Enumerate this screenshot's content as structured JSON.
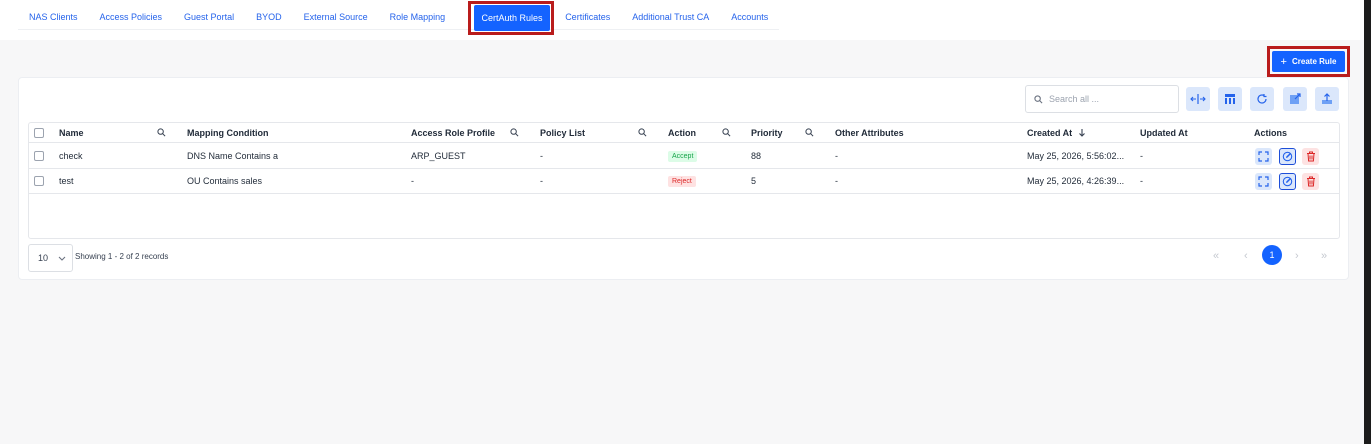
{
  "nav": {
    "tabs": [
      "NAS Clients",
      "Access Policies",
      "Guest Portal",
      "BYOD",
      "External Source",
      "Role Mapping",
      "CertAuth Rules",
      "Certificates",
      "Additional Trust CA",
      "Accounts"
    ],
    "active_tab": "CertAuth Rules"
  },
  "toolbar": {
    "create_label": "Create Rule",
    "search_placeholder": "Search all ..."
  },
  "table": {
    "columns": [
      "Name",
      "Mapping Condition",
      "Access Role Profile",
      "Policy List",
      "Action",
      "Priority",
      "Other Attributes",
      "Created At",
      "Updated At",
      "Actions"
    ],
    "rows": [
      {
        "name": "check",
        "condition": "DNS Name Contains a",
        "role_profile": "ARP_GUEST",
        "policy_list": "-",
        "action": "Accept",
        "priority": "88",
        "other": "-",
        "created": "May 25, 2026, 5:56:02...",
        "updated": "-"
      },
      {
        "name": "test",
        "condition": "OU Contains sales",
        "role_profile": "-",
        "policy_list": "-",
        "action": "Reject",
        "priority": "5",
        "other": "-",
        "created": "May 25, 2026, 4:26:39...",
        "updated": "-"
      }
    ]
  },
  "pagination": {
    "page_size": "10",
    "showing": "Showing 1 - 2 of 2 records",
    "current_page": "1"
  },
  "colors": {
    "accent": "#1463ff",
    "highlight": "#b91c1c",
    "accept": "#16a34a",
    "reject": "#dc2626"
  }
}
